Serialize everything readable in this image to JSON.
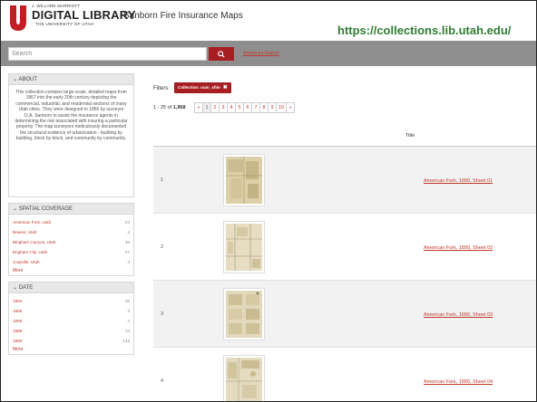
{
  "header": {
    "library_small": "J. WILLARD MARRIOTT",
    "library_main": "DIGITAL LIBRARY",
    "library_sub": "THE UNIVERSITY OF UTAH",
    "site_title": "Sanborn Fire Insurance Maps",
    "url_annotation": "https://collections.lib.utah.edu/"
  },
  "search": {
    "placeholder": "Search",
    "button_icon": "search-icon",
    "advanced_label": "Advanced Search"
  },
  "sidebar": {
    "about": {
      "heading": "ABOUT",
      "text": "This collection contains large-scale, detailed maps from 1867 into the early 20th century depicting the commercial, industrial, and residential sections of many Utah cities. They were designed in 1866 by surveyor D.A. Sanborn to assist fire insurance agents in determining the risk associated with insuring a particular property. The map surveyors meticulously documented the structural evidence of urbanization - building by building, block by block, and community by community."
    },
    "spatial": {
      "heading": "SPATIAL COVERAGE",
      "items": [
        {
          "label": "American Fork, Utah",
          "count": "24"
        },
        {
          "label": "Beaver, Utah",
          "count": "4"
        },
        {
          "label": "Bingham Canyon, Utah",
          "count": "45"
        },
        {
          "label": "Brigham City, Utah",
          "count": "27"
        },
        {
          "label": "Coalville, Utah",
          "count": "4"
        }
      ],
      "more": "More"
    },
    "date": {
      "heading": "DATE",
      "items": [
        {
          "label": "1884",
          "count": "28"
        },
        {
          "label": "1885",
          "count": "3"
        },
        {
          "label": "1888",
          "count": "4"
        },
        {
          "label": "1889",
          "count": "74"
        },
        {
          "label": "1890",
          "count": "146"
        }
      ],
      "more": "More"
    }
  },
  "main": {
    "filters_label": "Filters:",
    "filter_chip": "Collection: uum_sfim",
    "count_range": "1 - 25",
    "count_of": "of",
    "count_total": "1,968",
    "pager": [
      "«",
      "1",
      "2",
      "3",
      "4",
      "5",
      "6",
      "7",
      "8",
      "9",
      "10",
      "»"
    ],
    "column_title": "Title",
    "rows": [
      {
        "num": "1",
        "title": "American Fork, 1890, Sheet 01"
      },
      {
        "num": "2",
        "title": "American Fork, 1890, Sheet 02"
      },
      {
        "num": "3",
        "title": "American Fork, 1890, Sheet 03"
      },
      {
        "num": "4",
        "title": "American Fork, 1890, Sheet 04"
      }
    ]
  },
  "colors": {
    "brand_red": "#a61e22",
    "link_red": "#c0392b",
    "url_green": "#2e7d32",
    "search_bar_gray": "#8e8e8e"
  }
}
